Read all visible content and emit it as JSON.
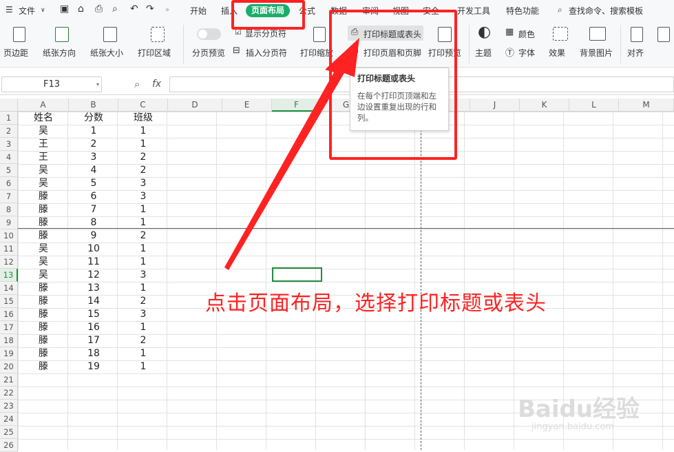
{
  "menu": {
    "file": "文件",
    "tabs": [
      "开始",
      "插入",
      "页面布局",
      "公式",
      "数据",
      "审阅",
      "视图",
      "安全",
      "开发工具",
      "特色功能"
    ],
    "search": "查找命令、搜索模板"
  },
  "ribbon": {
    "margins": "页边距",
    "orientation": "纸张方向",
    "size": "纸张大小",
    "print_area": "打印区域",
    "page_break_preview": "分页预览",
    "show_page_break": "显示分页符",
    "insert_page_break": "插入分页符",
    "print_scale": "打印缩放",
    "print_titles": "打印标题或表头",
    "print_header_footer": "打印页眉和页脚",
    "print_preview": "打印预览",
    "theme": "主题",
    "colors": "颜色",
    "fonts": "字体",
    "effects": "效果",
    "background": "背景图片",
    "align": "对齐"
  },
  "tooltip": {
    "title": "打印标题或表头",
    "body": "在每个打印页顶端和左边设置重复出现的行和列。"
  },
  "formula": {
    "namebox": "F13",
    "fx": "fx"
  },
  "columns": [
    "A",
    "B",
    "C",
    "D",
    "E",
    "F",
    "G",
    "H",
    "I",
    "J",
    "K",
    "L",
    "M"
  ],
  "rows": [
    "1",
    "2",
    "3",
    "4",
    "5",
    "6",
    "7",
    "8",
    "9",
    "10",
    "11",
    "12",
    "13",
    "14",
    "15",
    "16",
    "17",
    "18",
    "19",
    "20",
    "21",
    "22",
    "23",
    "24",
    "25",
    "26"
  ],
  "table": {
    "headers": [
      "姓名",
      "分数",
      "班级"
    ],
    "data": [
      [
        "吴",
        "1",
        "1"
      ],
      [
        "王",
        "2",
        "1"
      ],
      [
        "王",
        "3",
        "2"
      ],
      [
        "吴",
        "4",
        "2"
      ],
      [
        "吴",
        "5",
        "3"
      ],
      [
        "滕",
        "6",
        "3"
      ],
      [
        "滕",
        "7",
        "1"
      ],
      [
        "滕",
        "8",
        "1"
      ],
      [
        "滕",
        "9",
        "2"
      ],
      [
        "吴",
        "10",
        "1"
      ],
      [
        "吴",
        "11",
        "1"
      ],
      [
        "吴",
        "12",
        "3"
      ],
      [
        "滕",
        "13",
        "1"
      ],
      [
        "滕",
        "14",
        "2"
      ],
      [
        "滕",
        "15",
        "3"
      ],
      [
        "滕",
        "16",
        "1"
      ],
      [
        "滕",
        "17",
        "2"
      ],
      [
        "滕",
        "18",
        "1"
      ],
      [
        "滕",
        "19",
        "1"
      ]
    ]
  },
  "annotation": "点击页面布局，选择打印标题或表头",
  "watermark": "Baidu经验",
  "watermark_url": "jingyan.baidu.com",
  "colors": {
    "accent_tab": "#1aad6a",
    "annotation": "#ff2222",
    "selected_cell": "#1e8e3e"
  }
}
